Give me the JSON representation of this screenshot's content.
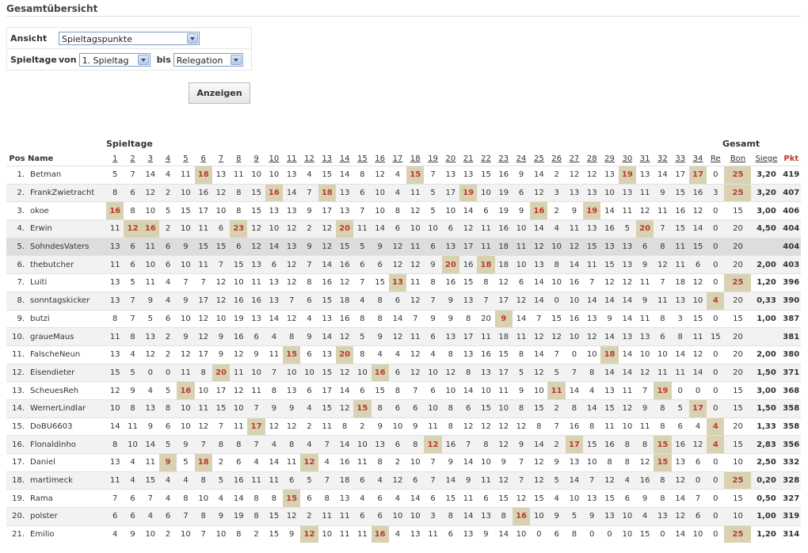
{
  "page_title": "Gesamtübersicht",
  "filter": {
    "ansicht_label": "Ansicht",
    "ansicht_value": "Spieltagspunkte",
    "spieltage_label": "Spieltage",
    "von_label": "von",
    "von_value": "1. Spieltag",
    "bis_label": "bis",
    "bis_value": "Relegation",
    "button": "Anzeigen"
  },
  "headers": {
    "spieltage_group": "Spieltage",
    "gesamt_group": "Gesamt",
    "pos": "Pos",
    "name": "Name",
    "matchdays": [
      "1",
      "2",
      "3",
      "4",
      "5",
      "6",
      "7",
      "8",
      "9",
      "10",
      "11",
      "12",
      "13",
      "14",
      "15",
      "16",
      "17",
      "18",
      "19",
      "20",
      "21",
      "22",
      "23",
      "24",
      "25",
      "26",
      "27",
      "28",
      "29",
      "30",
      "31",
      "32",
      "33",
      "34",
      "Re"
    ],
    "bon": "Bon",
    "siege": "Siege",
    "pkt": "Pkt"
  },
  "rows": [
    {
      "pos": "1.",
      "name": "Betman",
      "scores": [
        "5",
        "7",
        "14",
        "4",
        "11",
        "18",
        "13",
        "11",
        "10",
        "10",
        "13",
        "4",
        "15",
        "14",
        "8",
        "12",
        "4",
        "15",
        "7",
        "13",
        "13",
        "15",
        "16",
        "9",
        "14",
        "2",
        "12",
        "12",
        "13",
        "19",
        "13",
        "14",
        "17",
        "17",
        "0"
      ],
      "hl": [
        5,
        17,
        29,
        33
      ],
      "bon": "25",
      "bon_hl": true,
      "siege": "3,20",
      "pkt": "419"
    },
    {
      "pos": "2.",
      "name": "FrankZwietracht",
      "scores": [
        "8",
        "6",
        "12",
        "2",
        "10",
        "16",
        "12",
        "8",
        "15",
        "16",
        "14",
        "7",
        "18",
        "13",
        "6",
        "10",
        "4",
        "11",
        "5",
        "17",
        "19",
        "10",
        "19",
        "6",
        "12",
        "3",
        "13",
        "13",
        "10",
        "13",
        "11",
        "9",
        "15",
        "16",
        "3"
      ],
      "hl": [
        9,
        12,
        20
      ],
      "bon": "25",
      "bon_hl": true,
      "siege": "3,20",
      "pkt": "407"
    },
    {
      "pos": "3.",
      "name": "okoe",
      "scores": [
        "16",
        "8",
        "10",
        "5",
        "15",
        "17",
        "10",
        "8",
        "15",
        "13",
        "13",
        "9",
        "17",
        "13",
        "7",
        "10",
        "8",
        "12",
        "5",
        "10",
        "14",
        "6",
        "19",
        "9",
        "16",
        "2",
        "9",
        "19",
        "14",
        "11",
        "12",
        "11",
        "16",
        "12",
        "0"
      ],
      "hl": [
        0,
        24,
        27
      ],
      "bon": "15",
      "bon_hl": false,
      "siege": "3,00",
      "pkt": "406"
    },
    {
      "pos": "4.",
      "name": "Erwin",
      "scores": [
        "11",
        "12",
        "16",
        "2",
        "10",
        "11",
        "6",
        "23",
        "12",
        "10",
        "12",
        "2",
        "12",
        "20",
        "11",
        "14",
        "6",
        "10",
        "10",
        "6",
        "12",
        "11",
        "16",
        "10",
        "14",
        "4",
        "11",
        "13",
        "16",
        "5",
        "20",
        "7",
        "15",
        "14",
        "0"
      ],
      "hl": [
        1,
        2,
        7,
        13,
        30
      ],
      "bon": "20",
      "bon_hl": false,
      "siege": "4,50",
      "pkt": "404"
    },
    {
      "pos": "5.",
      "name": "SohndesVaters",
      "scores": [
        "13",
        "6",
        "11",
        "6",
        "9",
        "15",
        "15",
        "6",
        "12",
        "14",
        "13",
        "9",
        "12",
        "15",
        "5",
        "9",
        "12",
        "11",
        "6",
        "13",
        "17",
        "11",
        "18",
        "11",
        "12",
        "10",
        "12",
        "15",
        "13",
        "13",
        "6",
        "8",
        "11",
        "15",
        "0"
      ],
      "hl": [],
      "bon": "20",
      "bon_hl": false,
      "siege": "",
      "pkt": "404",
      "sel": true
    },
    {
      "pos": "6.",
      "name": "thebutcher",
      "scores": [
        "11",
        "6",
        "10",
        "6",
        "10",
        "11",
        "7",
        "15",
        "13",
        "6",
        "12",
        "7",
        "14",
        "16",
        "6",
        "6",
        "12",
        "12",
        "9",
        "20",
        "16",
        "18",
        "18",
        "10",
        "13",
        "8",
        "14",
        "11",
        "15",
        "13",
        "9",
        "12",
        "11",
        "6",
        "0"
      ],
      "hl": [
        19,
        21
      ],
      "bon": "20",
      "bon_hl": false,
      "siege": "2,00",
      "pkt": "403"
    },
    {
      "pos": "7.",
      "name": "Luiti",
      "scores": [
        "13",
        "5",
        "11",
        "4",
        "7",
        "7",
        "12",
        "10",
        "11",
        "13",
        "12",
        "8",
        "16",
        "12",
        "7",
        "15",
        "13",
        "11",
        "8",
        "16",
        "15",
        "8",
        "12",
        "6",
        "14",
        "10",
        "16",
        "7",
        "12",
        "12",
        "11",
        "7",
        "18",
        "12",
        "0"
      ],
      "hl": [
        16
      ],
      "bon": "25",
      "bon_hl": true,
      "siege": "1,20",
      "pkt": "396"
    },
    {
      "pos": "8.",
      "name": "sonntagskicker",
      "scores": [
        "13",
        "7",
        "9",
        "4",
        "9",
        "17",
        "12",
        "16",
        "16",
        "13",
        "7",
        "6",
        "15",
        "18",
        "4",
        "8",
        "6",
        "12",
        "7",
        "9",
        "13",
        "7",
        "17",
        "12",
        "14",
        "0",
        "10",
        "14",
        "14",
        "14",
        "9",
        "11",
        "13",
        "10",
        "4"
      ],
      "hl": [
        34
      ],
      "bon": "20",
      "bon_hl": false,
      "siege": "0,33",
      "pkt": "390"
    },
    {
      "pos": "9.",
      "name": "butzi",
      "scores": [
        "8",
        "7",
        "5",
        "6",
        "10",
        "12",
        "10",
        "19",
        "13",
        "14",
        "12",
        "4",
        "13",
        "16",
        "8",
        "8",
        "14",
        "7",
        "9",
        "9",
        "8",
        "20",
        "9",
        "14",
        "7",
        "15",
        "16",
        "13",
        "9",
        "14",
        "11",
        "8",
        "3",
        "15",
        "0"
      ],
      "hl": [
        22
      ],
      "bon": "15",
      "bon_hl": false,
      "siege": "1,00",
      "pkt": "387"
    },
    {
      "pos": "10.",
      "name": "graueMaus",
      "scores": [
        "11",
        "8",
        "13",
        "2",
        "9",
        "12",
        "9",
        "16",
        "6",
        "4",
        "8",
        "9",
        "14",
        "12",
        "5",
        "9",
        "12",
        "11",
        "6",
        "13",
        "17",
        "11",
        "18",
        "11",
        "12",
        "12",
        "10",
        "12",
        "14",
        "13",
        "13",
        "6",
        "8",
        "11",
        "15"
      ],
      "hl": [],
      "bon": "20",
      "bon_hl": false,
      "siege": "",
      "pkt": "381"
    },
    {
      "pos": "11.",
      "name": "FalscheNeun",
      "scores": [
        "13",
        "4",
        "12",
        "2",
        "12",
        "17",
        "9",
        "12",
        "9",
        "11",
        "15",
        "6",
        "13",
        "20",
        "8",
        "4",
        "4",
        "12",
        "4",
        "8",
        "13",
        "16",
        "15",
        "8",
        "14",
        "7",
        "0",
        "10",
        "18",
        "14",
        "10",
        "10",
        "14",
        "12",
        "0"
      ],
      "hl": [
        10,
        13,
        28
      ],
      "bon": "20",
      "bon_hl": false,
      "siege": "2,00",
      "pkt": "380"
    },
    {
      "pos": "12.",
      "name": "Eisendieter",
      "scores": [
        "15",
        "5",
        "0",
        "0",
        "11",
        "8",
        "20",
        "11",
        "10",
        "7",
        "10",
        "10",
        "15",
        "12",
        "10",
        "16",
        "6",
        "12",
        "10",
        "12",
        "8",
        "13",
        "17",
        "5",
        "12",
        "5",
        "7",
        "8",
        "14",
        "14",
        "12",
        "11",
        "11",
        "14",
        "0"
      ],
      "hl": [
        6,
        15
      ],
      "bon": "20",
      "bon_hl": false,
      "siege": "1,50",
      "pkt": "371"
    },
    {
      "pos": "13.",
      "name": "ScheuesReh",
      "scores": [
        "12",
        "9",
        "4",
        "5",
        "16",
        "10",
        "17",
        "12",
        "11",
        "8",
        "13",
        "6",
        "17",
        "14",
        "6",
        "15",
        "8",
        "7",
        "6",
        "10",
        "14",
        "10",
        "11",
        "9",
        "10",
        "11",
        "14",
        "4",
        "13",
        "11",
        "7",
        "19",
        "0",
        "0",
        "0"
      ],
      "hl": [
        4,
        25,
        31
      ],
      "bon": "15",
      "bon_hl": false,
      "siege": "3,00",
      "pkt": "368"
    },
    {
      "pos": "14.",
      "name": "WernerLindlar",
      "scores": [
        "10",
        "8",
        "13",
        "8",
        "10",
        "11",
        "15",
        "10",
        "7",
        "9",
        "9",
        "4",
        "15",
        "12",
        "15",
        "8",
        "6",
        "6",
        "10",
        "8",
        "6",
        "15",
        "10",
        "8",
        "15",
        "2",
        "8",
        "14",
        "15",
        "12",
        "9",
        "8",
        "5",
        "17",
        "0"
      ],
      "hl": [
        14,
        33
      ],
      "bon": "15",
      "bon_hl": false,
      "siege": "1,50",
      "pkt": "358"
    },
    {
      "pos": "15.",
      "name": "DoBU6603",
      "scores": [
        "14",
        "11",
        "9",
        "6",
        "10",
        "12",
        "7",
        "11",
        "17",
        "12",
        "12",
        "2",
        "11",
        "8",
        "2",
        "9",
        "10",
        "9",
        "11",
        "8",
        "12",
        "12",
        "12",
        "12",
        "8",
        "7",
        "16",
        "8",
        "11",
        "10",
        "11",
        "8",
        "6",
        "4",
        "4"
      ],
      "hl": [
        8,
        34
      ],
      "bon": "20",
      "bon_hl": false,
      "siege": "1,33",
      "pkt": "358"
    },
    {
      "pos": "16.",
      "name": "Flonaldinho",
      "scores": [
        "8",
        "10",
        "14",
        "5",
        "9",
        "7",
        "8",
        "8",
        "7",
        "4",
        "8",
        "4",
        "7",
        "14",
        "10",
        "13",
        "6",
        "8",
        "12",
        "16",
        "7",
        "8",
        "12",
        "9",
        "14",
        "2",
        "17",
        "15",
        "16",
        "8",
        "8",
        "15",
        "16",
        "12",
        "4"
      ],
      "hl": [
        18,
        26,
        31,
        34
      ],
      "bon": "15",
      "bon_hl": false,
      "siege": "2,83",
      "pkt": "356"
    },
    {
      "pos": "17.",
      "name": "Daniel",
      "scores": [
        "13",
        "4",
        "11",
        "9",
        "5",
        "18",
        "2",
        "6",
        "4",
        "14",
        "11",
        "12",
        "4",
        "16",
        "11",
        "8",
        "2",
        "10",
        "7",
        "9",
        "14",
        "10",
        "9",
        "7",
        "12",
        "9",
        "13",
        "10",
        "8",
        "8",
        "12",
        "15",
        "13",
        "6",
        "0"
      ],
      "hl": [
        3,
        5,
        11,
        31
      ],
      "bon": "10",
      "bon_hl": false,
      "siege": "2,50",
      "pkt": "332"
    },
    {
      "pos": "18.",
      "name": "martimeck",
      "scores": [
        "11",
        "4",
        "15",
        "4",
        "4",
        "8",
        "5",
        "16",
        "11",
        "11",
        "6",
        "5",
        "7",
        "18",
        "6",
        "4",
        "12",
        "6",
        "7",
        "14",
        "9",
        "11",
        "12",
        "7",
        "12",
        "5",
        "14",
        "7",
        "12",
        "4",
        "16",
        "8",
        "12",
        "0",
        "0"
      ],
      "hl": [],
      "bon": "25",
      "bon_hl": true,
      "siege": "0,20",
      "pkt": "328"
    },
    {
      "pos": "19.",
      "name": "Rama",
      "scores": [
        "7",
        "6",
        "7",
        "4",
        "8",
        "10",
        "4",
        "14",
        "8",
        "8",
        "15",
        "6",
        "8",
        "13",
        "4",
        "6",
        "4",
        "14",
        "6",
        "15",
        "11",
        "6",
        "15",
        "12",
        "15",
        "4",
        "10",
        "13",
        "15",
        "6",
        "9",
        "8",
        "14",
        "7",
        "0"
      ],
      "hl": [
        10
      ],
      "bon": "15",
      "bon_hl": false,
      "siege": "0,50",
      "pkt": "327"
    },
    {
      "pos": "20.",
      "name": "polster",
      "scores": [
        "6",
        "6",
        "4",
        "6",
        "7",
        "8",
        "9",
        "19",
        "8",
        "15",
        "12",
        "2",
        "11",
        "11",
        "6",
        "6",
        "10",
        "10",
        "3",
        "8",
        "14",
        "13",
        "8",
        "16",
        "10",
        "9",
        "5",
        "9",
        "13",
        "10",
        "4",
        "13",
        "12",
        "6",
        "0"
      ],
      "hl": [
        23
      ],
      "bon": "10",
      "bon_hl": false,
      "siege": "1,00",
      "pkt": "319"
    },
    {
      "pos": "21.",
      "name": "Emilio",
      "scores": [
        "4",
        "9",
        "10",
        "2",
        "10",
        "7",
        "10",
        "8",
        "2",
        "15",
        "9",
        "12",
        "10",
        "11",
        "11",
        "16",
        "4",
        "13",
        "11",
        "6",
        "13",
        "9",
        "14",
        "10",
        "0",
        "6",
        "8",
        "0",
        "0",
        "10",
        "15",
        "0",
        "14",
        "10",
        "0"
      ],
      "hl": [
        11,
        15
      ],
      "bon": "25",
      "bon_hl": true,
      "siege": "1,20",
      "pkt": "314"
    }
  ]
}
